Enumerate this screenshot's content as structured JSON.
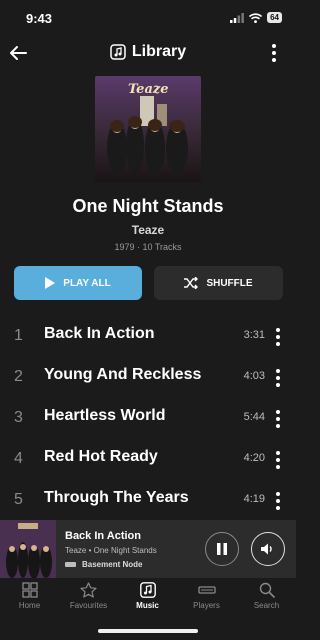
{
  "status": {
    "time": "9:43",
    "battery": "64"
  },
  "header": {
    "title": "Library",
    "back_icon": "back-arrow-icon",
    "more_icon": "more-vertical-icon"
  },
  "album": {
    "title": "One Night Stands",
    "artist": "Teaze",
    "meta": "1979 · 10 Tracks",
    "art_logo": "Teaze"
  },
  "actions": {
    "play_all": "PLAY ALL",
    "shuffle": "SHUFFLE"
  },
  "accent": "#5aaedb",
  "tracks": [
    {
      "num": "1",
      "title": "Back In Action",
      "duration": "3:31"
    },
    {
      "num": "2",
      "title": "Young And Reckless",
      "duration": "4:03"
    },
    {
      "num": "3",
      "title": "Heartless World",
      "duration": "5:44"
    },
    {
      "num": "4",
      "title": "Red Hot Ready",
      "duration": "4:20"
    },
    {
      "num": "5",
      "title": "Through The Years",
      "duration": "4:19"
    }
  ],
  "now_playing": {
    "title": "Back In Action",
    "subtitle": "Teaze • One Night Stands",
    "node": "Basement Node"
  },
  "tabs": [
    {
      "label": "Home",
      "icon": "grid-icon",
      "active": false
    },
    {
      "label": "Favourites",
      "icon": "star-icon",
      "active": false
    },
    {
      "label": "Music",
      "icon": "music-note-icon",
      "active": true
    },
    {
      "label": "Players",
      "icon": "player-device-icon",
      "active": false
    },
    {
      "label": "Search",
      "icon": "search-icon",
      "active": false
    }
  ]
}
